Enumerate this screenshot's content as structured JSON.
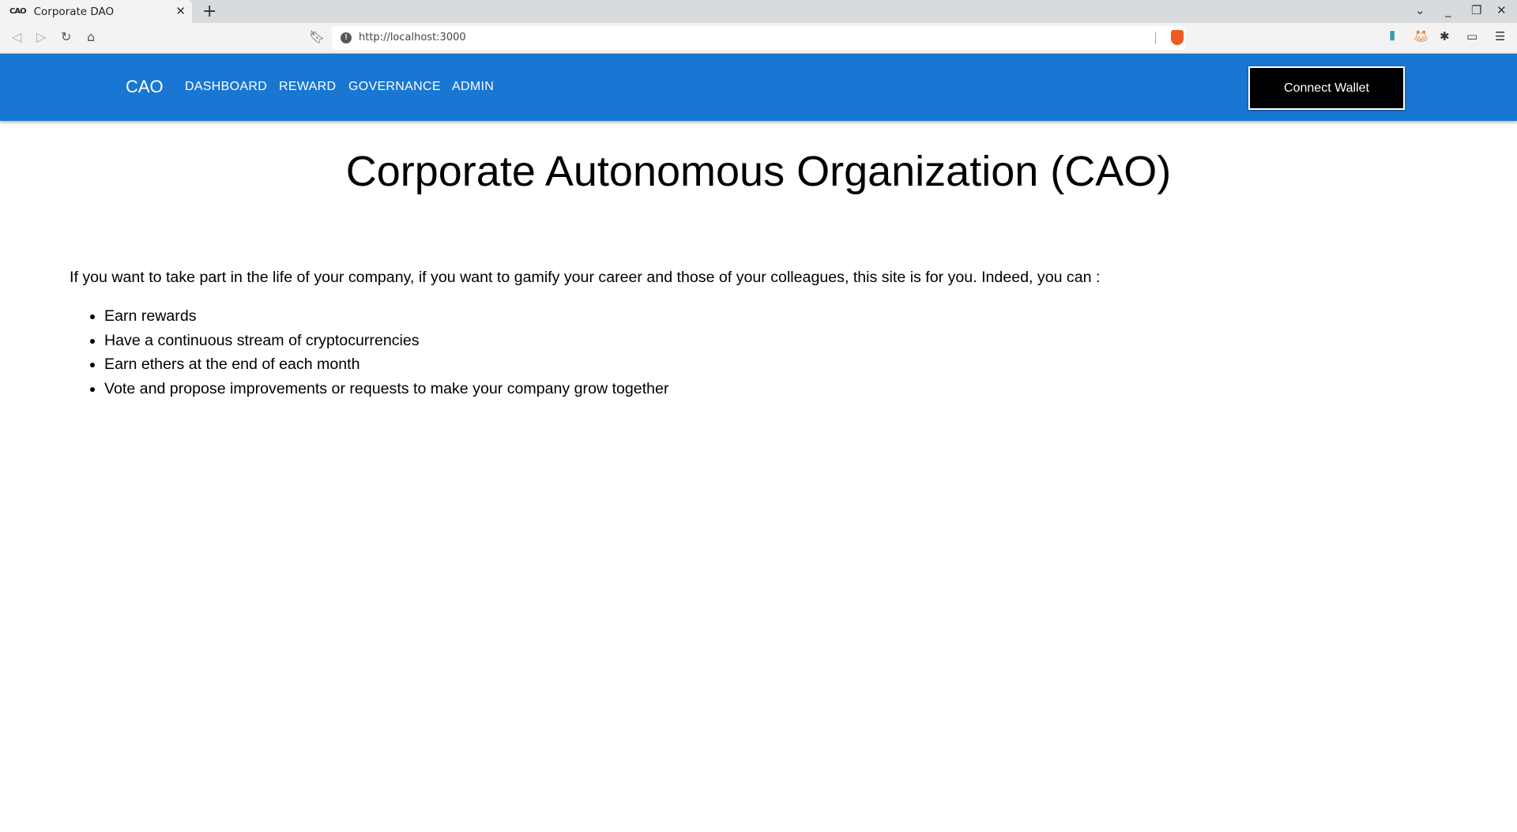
{
  "browser": {
    "tab_title": "Corporate DAO",
    "tab_favicon_text": "CAO",
    "url": "http://localhost:3000",
    "icons": [
      "back-icon",
      "forward-icon",
      "reload-icon",
      "home-icon",
      "bookmark-icon",
      "info-icon",
      "brave-shields-icon",
      "extension-icon",
      "metamask-icon",
      "puzzle-icon",
      "wallet-icon",
      "menu-icon"
    ]
  },
  "nav": {
    "brand": "CAO",
    "links": [
      "DASHBOARD",
      "REWARD",
      "GOVERNANCE",
      "ADMIN"
    ],
    "connect_label": "Connect Wallet",
    "bg_color": "#1976d2"
  },
  "main": {
    "title": "Corporate Autonomous Organization (CAO)",
    "intro": "If you want to take part in the life of your company, if you want to gamify your career and those of your colleagues, this site is for you. Indeed, you can :",
    "items": [
      "Earn rewards",
      "Have a continuous stream of cryptocurrencies",
      "Earn ethers at the end of each month",
      "Vote and propose improvements or requests to make your company grow together"
    ]
  }
}
